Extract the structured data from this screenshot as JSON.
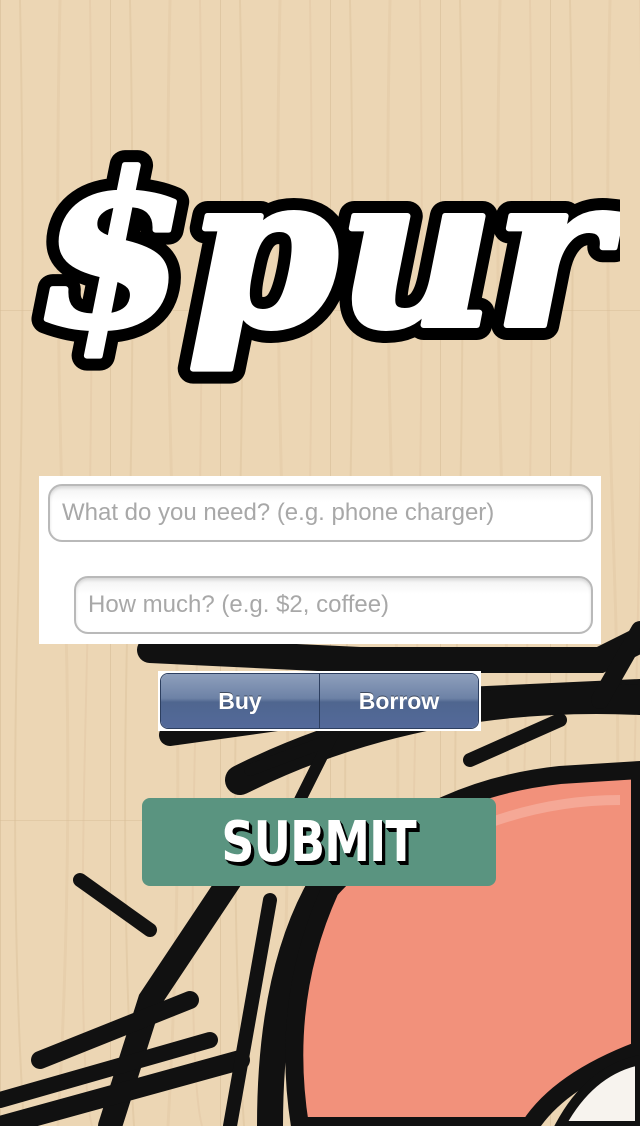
{
  "app": {
    "logo_text": "$pur"
  },
  "form": {
    "need_placeholder": "What do you need? (e.g. phone charger)",
    "amount_placeholder": "How much? (e.g. $2, coffee)",
    "need_value": "",
    "amount_value": ""
  },
  "segmented": {
    "options": [
      "Buy",
      "Borrow"
    ]
  },
  "submit": {
    "label": "SUBMIT"
  },
  "colors": {
    "wood": "#ead3b0",
    "accent_green": "#5a9480",
    "salmon": "#f2917b",
    "segment_blue": "#5d729b"
  },
  "icons": {
    "background": "wood-grain-with-sketch-artwork"
  }
}
